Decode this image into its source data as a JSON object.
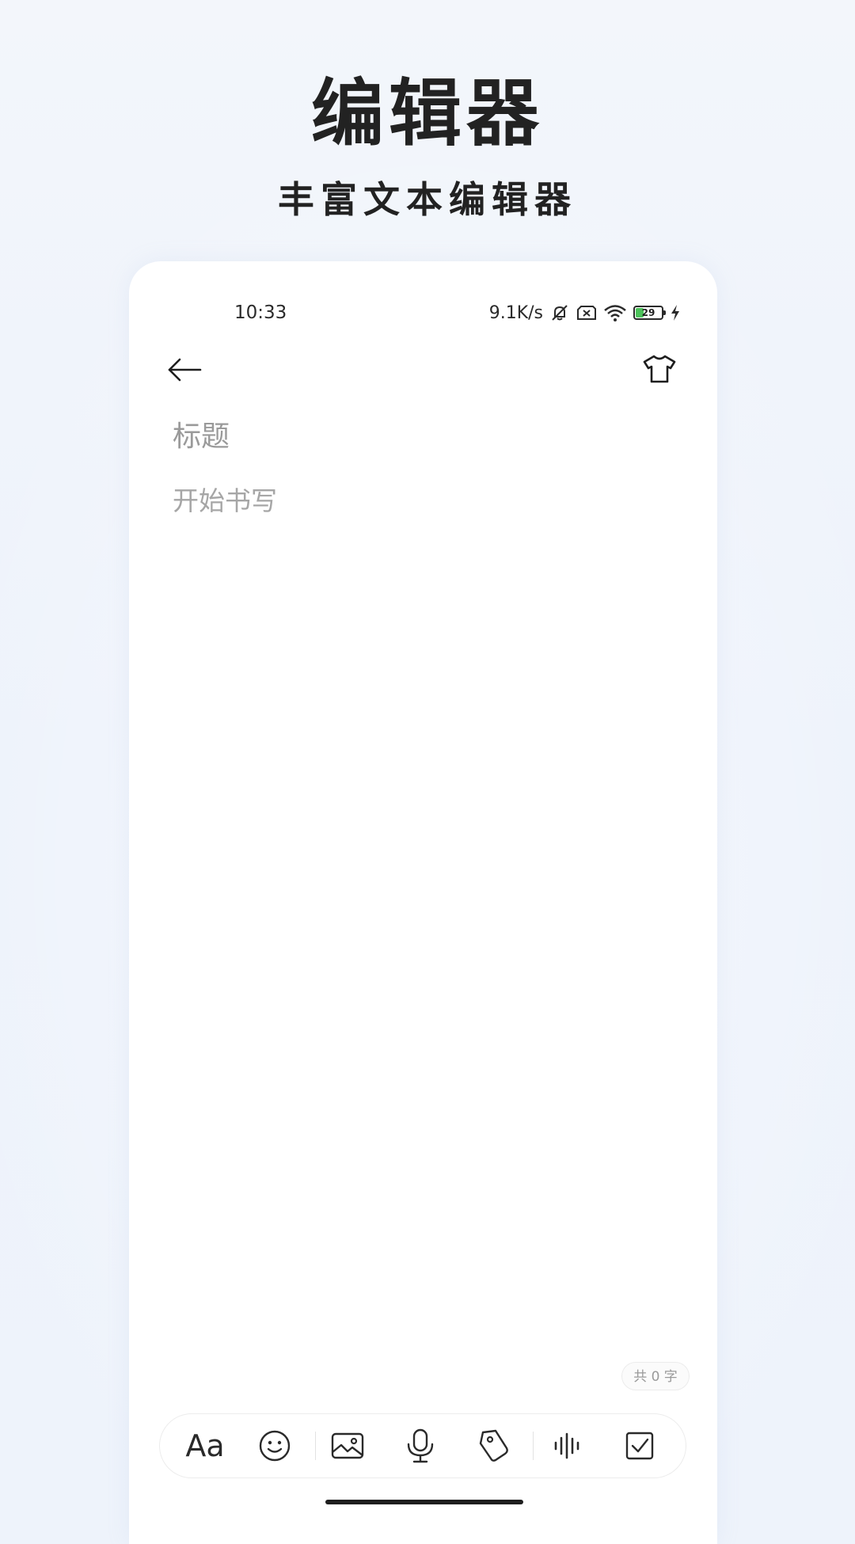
{
  "hero": {
    "title": "编辑器",
    "subtitle": "丰富文本编辑器"
  },
  "status_bar": {
    "time": "10:33",
    "net_speed": "9.1K/s",
    "battery_level": "29",
    "battery_fraction": 0.29,
    "icons": [
      "mute-bell-icon",
      "sim-off-icon",
      "wifi-icon",
      "battery-icon",
      "charging-bolt-icon"
    ]
  },
  "nav": {
    "back_icon": "arrow-left-icon",
    "theme_icon": "tshirt-icon"
  },
  "editor": {
    "title_placeholder": "标题",
    "body_placeholder": "开始书写",
    "word_count": "共 0 字"
  },
  "toolbar": {
    "font_label": "Aa",
    "items": [
      "text-style",
      "emoji-icon",
      "image-icon",
      "microphone-icon",
      "tag-icon",
      "audio-wave-icon",
      "checkbox-icon"
    ]
  },
  "colors": {
    "background": "#eef3fb",
    "card": "#ffffff",
    "text_primary": "#222222",
    "placeholder": "#9a9a9a",
    "battery_green": "#4cc25a"
  }
}
